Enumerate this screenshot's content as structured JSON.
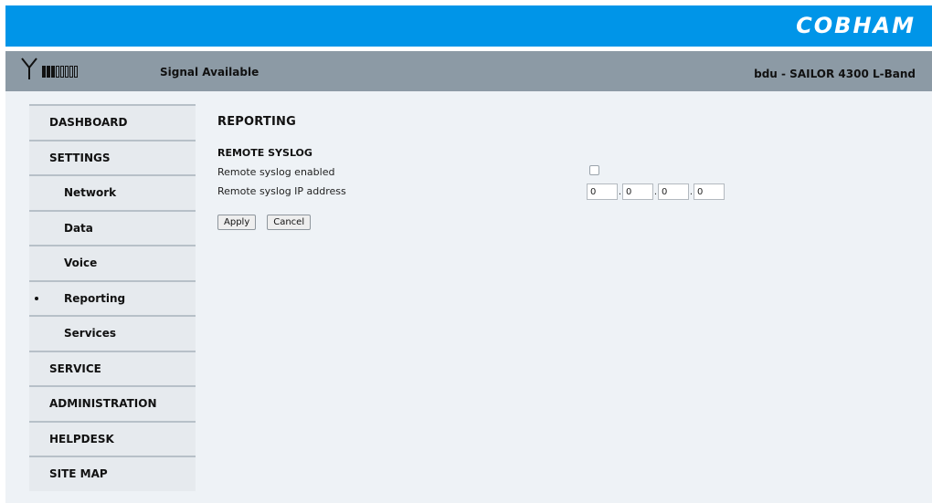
{
  "header": {
    "logo_text": "COBHAM",
    "signal_text": "Signal Available",
    "device_text": "bdu - SAILOR 4300 L-Band",
    "signal_strength": {
      "level": 3,
      "max": 8
    }
  },
  "sidebar": {
    "items": [
      {
        "label": "DASHBOARD",
        "level": "top",
        "active": false
      },
      {
        "label": "SETTINGS",
        "level": "top",
        "active": false
      },
      {
        "label": "Network",
        "level": "sub",
        "active": false
      },
      {
        "label": "Data",
        "level": "sub",
        "active": false
      },
      {
        "label": "Voice",
        "level": "sub",
        "active": false
      },
      {
        "label": "Reporting",
        "level": "sub",
        "active": true
      },
      {
        "label": "Services",
        "level": "sub",
        "active": false
      },
      {
        "label": "SERVICE",
        "level": "top",
        "active": false
      },
      {
        "label": "ADMINISTRATION",
        "level": "top",
        "active": false
      },
      {
        "label": "HELPDESK",
        "level": "top",
        "active": false
      },
      {
        "label": "SITE MAP",
        "level": "top",
        "active": false
      }
    ]
  },
  "main": {
    "title": "REPORTING",
    "section_title": "REMOTE SYSLOG",
    "syslog_enabled_label": "Remote syslog enabled",
    "syslog_enabled": false,
    "syslog_ip_label": "Remote syslog IP address",
    "ip": [
      "0",
      "0",
      "0",
      "0"
    ],
    "apply_label": "Apply",
    "cancel_label": "Cancel"
  },
  "colors": {
    "topbar": "#0095e8",
    "statusbar": "#8c9aa5",
    "background": "#eef2f6"
  }
}
